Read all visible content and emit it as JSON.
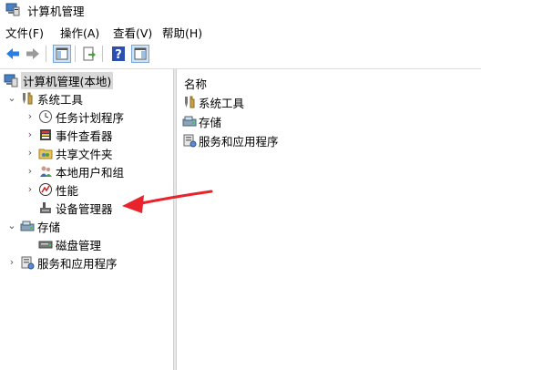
{
  "window": {
    "title": "计算机管理",
    "icon": "computer-management-icon"
  },
  "menu": [
    "文件(F)",
    "操作(A)",
    "查看(V)",
    "帮助(H)"
  ],
  "toolbar": [
    "back-arrow-icon",
    "forward-arrow-icon",
    "show-hide-console-tree-icon",
    "export-list-icon",
    "help-icon",
    "action-pane-icon"
  ],
  "tree": {
    "root": "计算机管理(本地)",
    "system_tools": "系统工具",
    "task_scheduler": "任务计划程序",
    "event_viewer": "事件查看器",
    "shared_folders": "共享文件夹",
    "local_users": "本地用户和组",
    "performance": "性能",
    "device_manager": "设备管理器",
    "storage": "存储",
    "disk_management": "磁盘管理",
    "services_apps": "服务和应用程序"
  },
  "list": {
    "header": "名称",
    "items": [
      "系统工具",
      "存储",
      "服务和应用程序"
    ]
  },
  "colors": {
    "arrow": "#e8232b",
    "back_arrow": "#2a7de1",
    "forward_arrow": "#9a9a9a",
    "help_blue": "#2a4fb4"
  }
}
